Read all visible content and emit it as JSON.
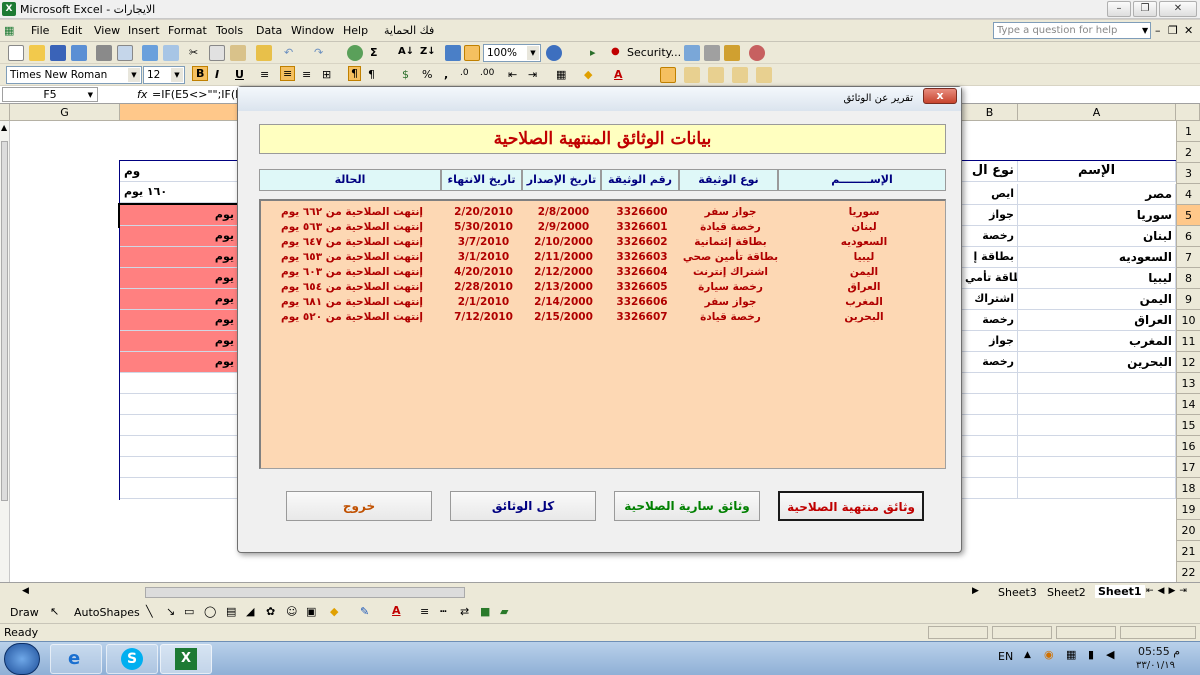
{
  "window": {
    "title": "Microsoft Excel - الايجارات",
    "icon": "excel-icon"
  },
  "menu": {
    "items": [
      "File",
      "Edit",
      "View",
      "Insert",
      "Format",
      "Tools",
      "Data",
      "Window",
      "Help",
      "فك الحماية"
    ],
    "help_placeholder": "Type a question for help"
  },
  "toolbar": {
    "zoom": "100%",
    "security_label": "Security...",
    "font_name": "Times New Roman",
    "font_size": "12"
  },
  "formula_bar": {
    "name_box": "F5",
    "fx": "fx",
    "formula": "=IF(E5<>\"\";IF(E"
  },
  "grid": {
    "columns": [
      "G",
      "B",
      "A"
    ],
    "rows": [
      "1",
      "2",
      "3",
      "4",
      "5",
      "6",
      "7",
      "8",
      "9",
      "10",
      "11",
      "12",
      "13",
      "14",
      "15",
      "16",
      "17",
      "18",
      "19",
      "20",
      "21",
      "22"
    ],
    "selected_row": "5",
    "header_A": "الإسم",
    "header_B": "نوع ال",
    "header_G": "وم",
    "names": [
      "مصر",
      "سوريا",
      "لبنان",
      "السعوديه",
      "ليبيا",
      "اليمن",
      "العراق",
      "المغرب",
      "البحرين"
    ],
    "types": [
      "ايص",
      "جواز",
      "رخصة",
      "بطاقة إ",
      "بطاقة تأمي",
      "اشتراك",
      "رخصة",
      "جواز",
      "رخصة"
    ],
    "g_row4": "١٦٠ يوم",
    "g_rows": [
      "يوم",
      "يوم",
      "يوم",
      "يوم",
      "يوم",
      "يوم",
      "يوم",
      "يوم"
    ],
    "highlight_color": "#ff8080"
  },
  "dialog": {
    "title": "تقرير عن الوثائق",
    "close_label": "x",
    "banner": "بيانات الوثائق المنتهية الصلاحية",
    "columns": [
      "الإســــــــم",
      "نوع الوثيقة",
      "رقم الوثيقة",
      "تاريخ الإصدار",
      "تاريخ الانتهاء",
      "الحالة"
    ],
    "rows": [
      {
        "name": "سوريا",
        "type": "جواز سفر",
        "number": "3326600",
        "issue": "2/8/2000",
        "expiry": "2/20/2010",
        "status": "إنتهت الصلاحية من ٦٦٢ يوم"
      },
      {
        "name": "لبنان",
        "type": "رخصة قيادة",
        "number": "3326601",
        "issue": "2/9/2000",
        "expiry": "5/30/2010",
        "status": "إنتهت الصلاحية من ٥٦٣ يوم"
      },
      {
        "name": "السعوديه",
        "type": "بطاقة إئتمانية",
        "number": "3326602",
        "issue": "2/10/2000",
        "expiry": "3/7/2010",
        "status": "إنتهت الصلاحية من ٦٤٧ يوم"
      },
      {
        "name": "ليبيا",
        "type": "بطاقة تأمين صحي",
        "number": "3326603",
        "issue": "2/11/2000",
        "expiry": "3/1/2010",
        "status": "إنتهت الصلاحية من ٦٥٣ يوم"
      },
      {
        "name": "اليمن",
        "type": "اشتراك إنترنت",
        "number": "3326604",
        "issue": "2/12/2000",
        "expiry": "4/20/2010",
        "status": "إنتهت الصلاحية من ٦٠٣ يوم"
      },
      {
        "name": "العراق",
        "type": "رخصة سيارة",
        "number": "3326605",
        "issue": "2/13/2000",
        "expiry": "2/28/2010",
        "status": "إنتهت الصلاحية من ٦٥٤ يوم"
      },
      {
        "name": "المغرب",
        "type": "جواز سفر",
        "number": "3326606",
        "issue": "2/14/2000",
        "expiry": "2/1/2010",
        "status": "إنتهت الصلاحية من ٦٨١ يوم"
      },
      {
        "name": "البحرين",
        "type": "رخصة قيادة",
        "number": "3326607",
        "issue": "2/15/2000",
        "expiry": "7/12/2010",
        "status": "إنتهت الصلاحية من ٥٢٠ يوم"
      }
    ],
    "buttons": {
      "expired": "وثائق منتهية الصلاحية",
      "valid": "وثائق سارية الصلاحية",
      "all": "كل الوثائق",
      "exit": "خروج"
    },
    "button_colors": {
      "expired": "#c00000",
      "valid": "#008000",
      "all": "#000080",
      "exit": "#c05000"
    },
    "list_bg": "#fdd8b4",
    "banner_bg": "#ffffc0"
  },
  "sheet_tabs": [
    "Sheet3",
    "Sheet2",
    "Sheet1"
  ],
  "active_sheet": "Sheet1",
  "draw_bar": {
    "draw": "Draw",
    "autoshapes": "AutoShapes"
  },
  "status": {
    "text": "Ready"
  },
  "taskbar": {
    "lang": "EN",
    "time": "05:55 م",
    "date": "٣٣/٠١/١٩"
  }
}
